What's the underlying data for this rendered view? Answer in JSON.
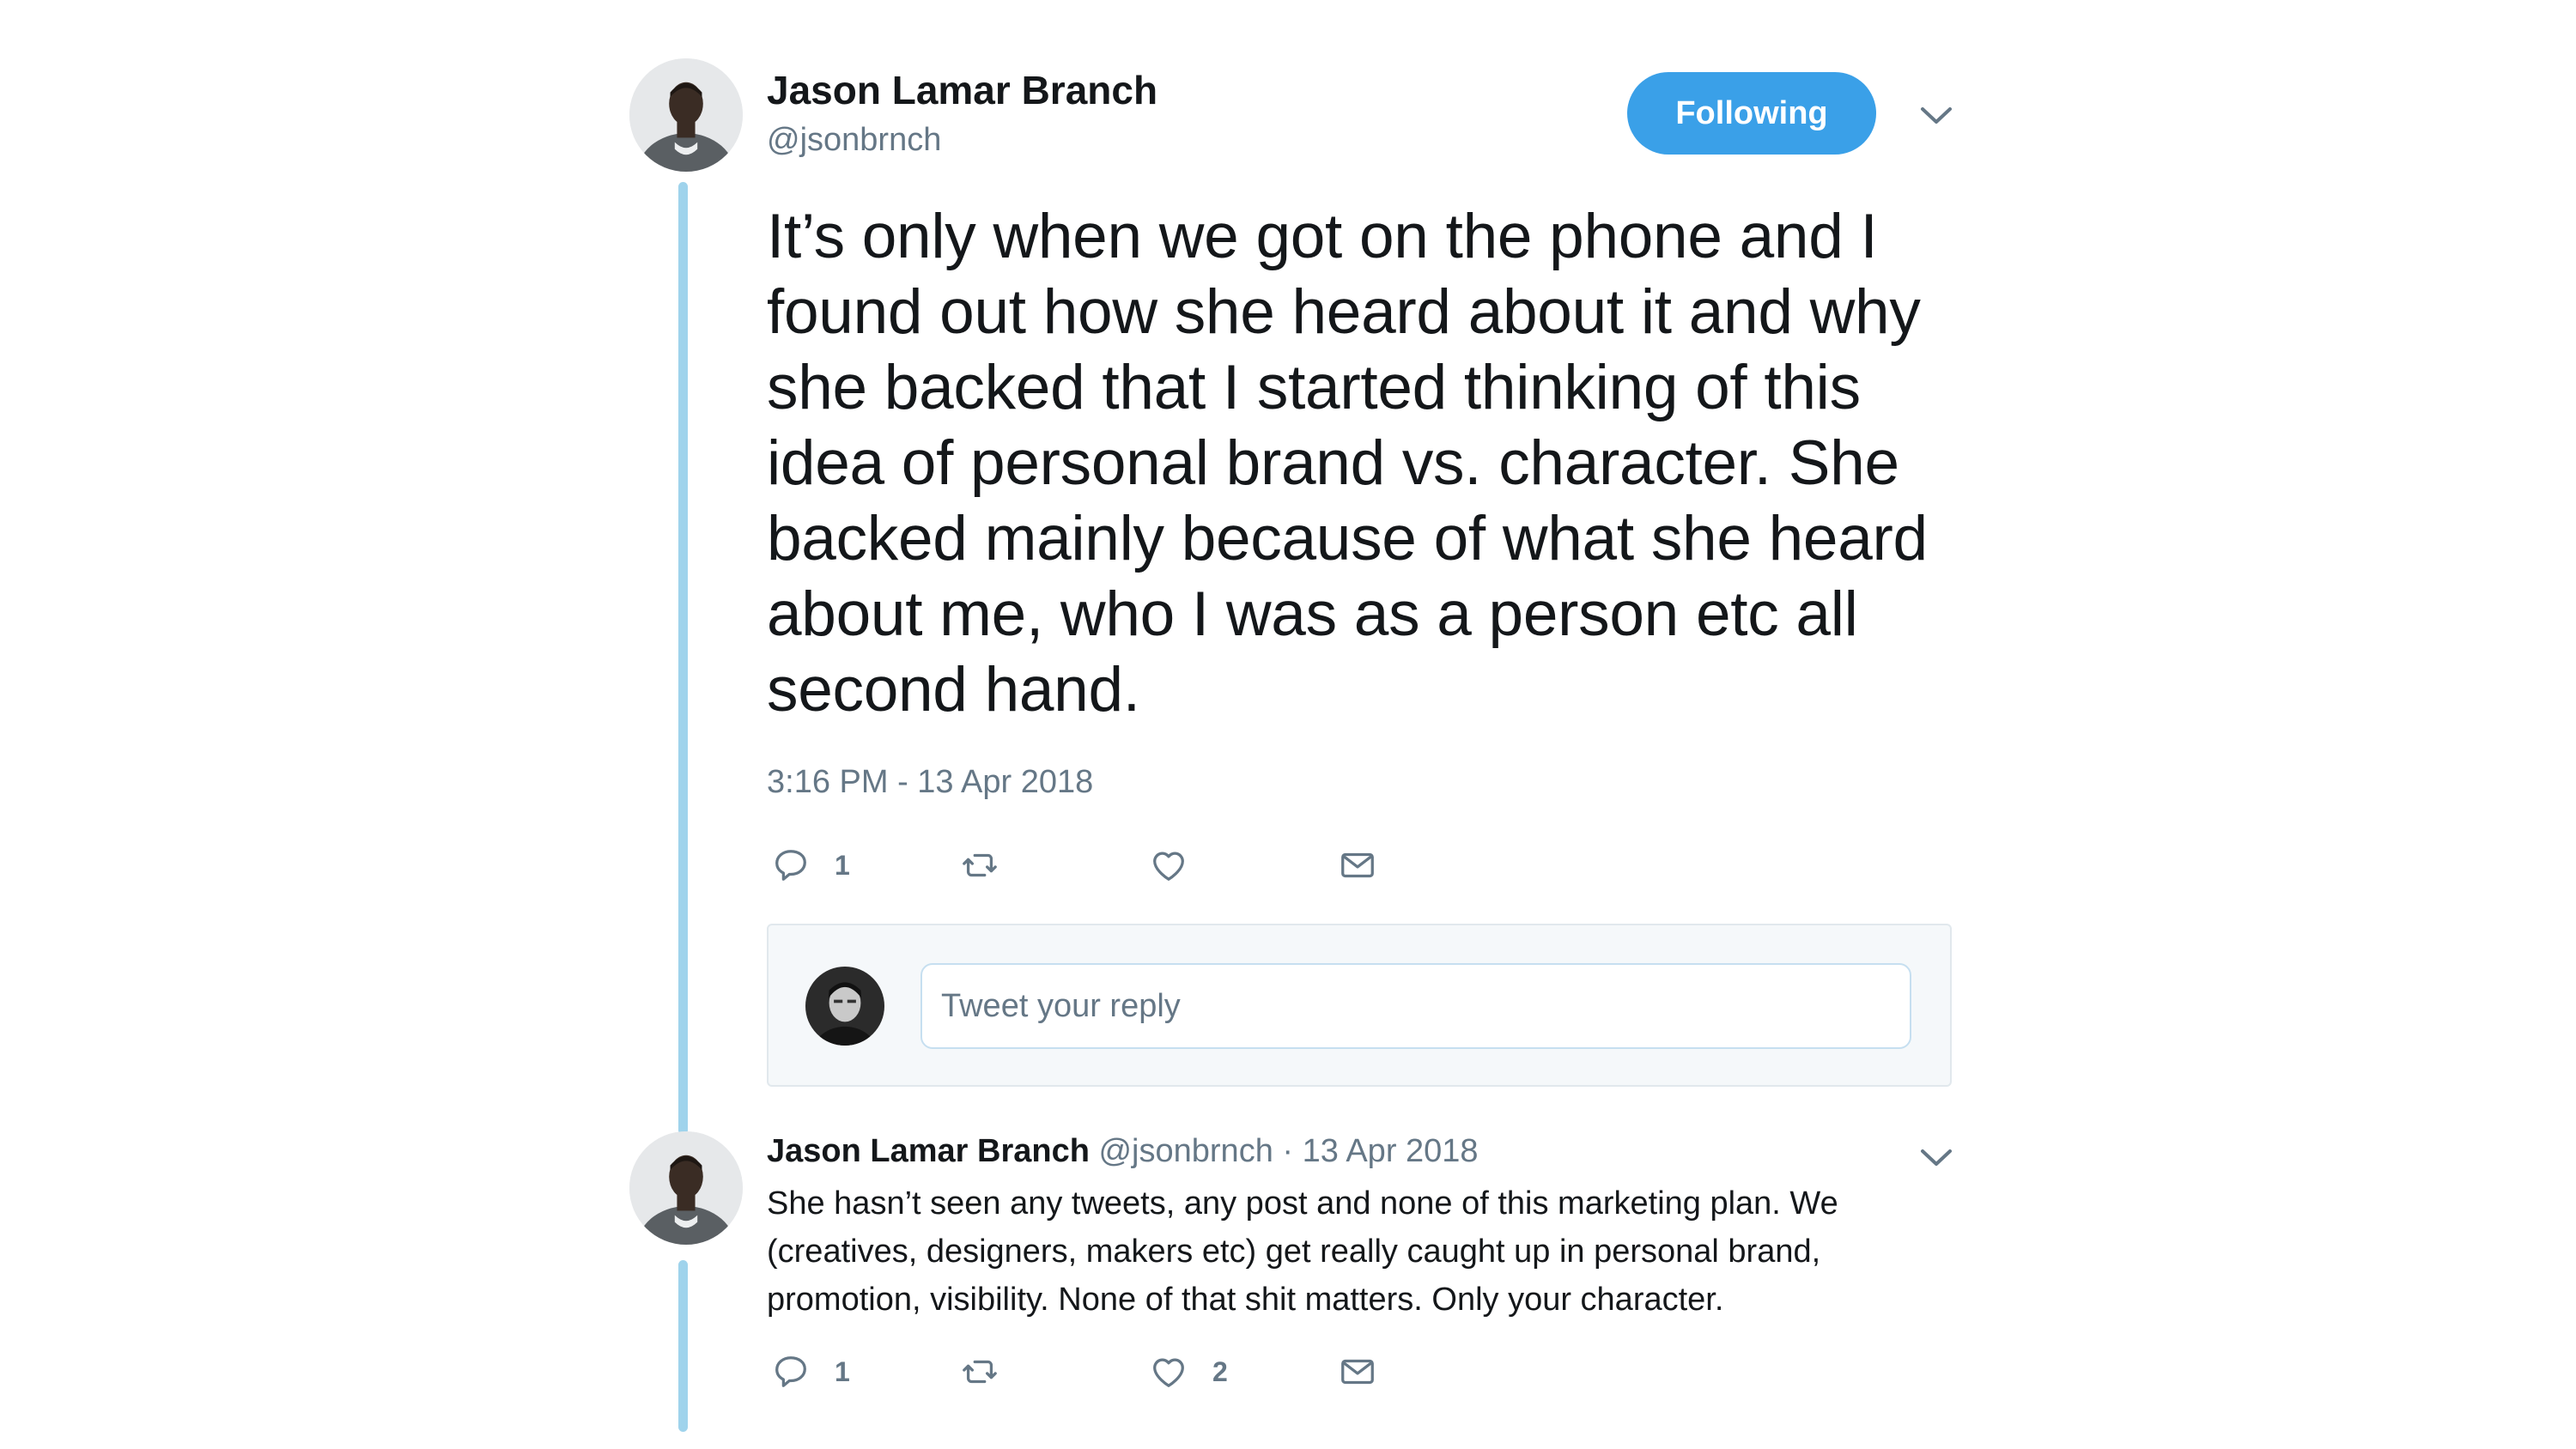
{
  "main_tweet": {
    "author_name": "Jason Lamar Branch",
    "author_handle": "@jsonbrnch",
    "follow_button_label": "Following",
    "text": "It’s only when we got on the phone and I found out how she heard about it and why she backed that I started thinking of this idea of personal brand vs. character. She backed mainly because of what she heard about me, who I was as a person etc all second hand.",
    "timestamp": "3:16 PM - 13 Apr 2018",
    "actions": {
      "reply_count": "1",
      "retweet_count": "",
      "like_count": "",
      "reply_icon": "comment-icon",
      "retweet_icon": "retweet-icon",
      "like_icon": "heart-icon",
      "message_icon": "envelope-icon"
    }
  },
  "reply_composer": {
    "placeholder": "Tweet your reply"
  },
  "reply_tweet": {
    "author_name": "Jason Lamar Branch",
    "author_handle": "@jsonbrnch",
    "separator": "·",
    "date": "13 Apr 2018",
    "text": "She hasn’t seen any tweets, any post and none of this marketing plan. We (creatives, designers, makers etc) get really caught up in personal brand, promotion, visibility. None of that shit matters. Only your character.",
    "actions": {
      "reply_count": "1",
      "retweet_count": "",
      "like_count": "2"
    }
  },
  "colors": {
    "accent": "#3aa0e8",
    "thread_line": "#9fd3ec",
    "secondary_text": "#657786",
    "icon": "#657786"
  }
}
